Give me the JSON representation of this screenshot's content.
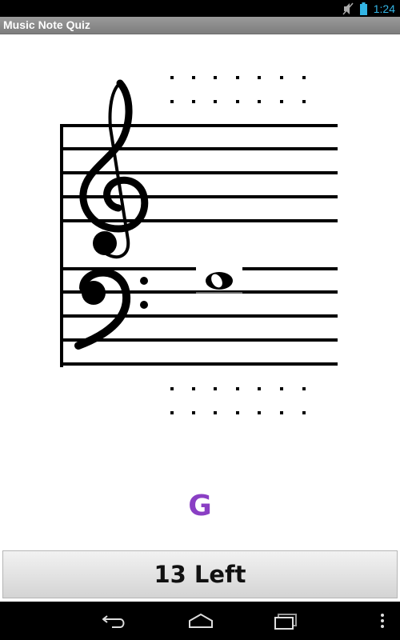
{
  "app": {
    "title": "Music Note Quiz"
  },
  "status_bar": {
    "time": "1:24",
    "icons": [
      "muted-icon",
      "battery-icon"
    ]
  },
  "quiz": {
    "answer_note": "G",
    "answer_color": "#8a3fc4",
    "remaining_label": "13 Left"
  },
  "staff": {
    "clefs": [
      "treble",
      "bass"
    ],
    "note": {
      "type": "whole",
      "clef": "bass",
      "position": "top line",
      "ledger": false
    }
  },
  "nav_bar": {
    "icons": [
      "back-icon",
      "home-icon",
      "recent-apps-icon",
      "menu-icon"
    ]
  }
}
